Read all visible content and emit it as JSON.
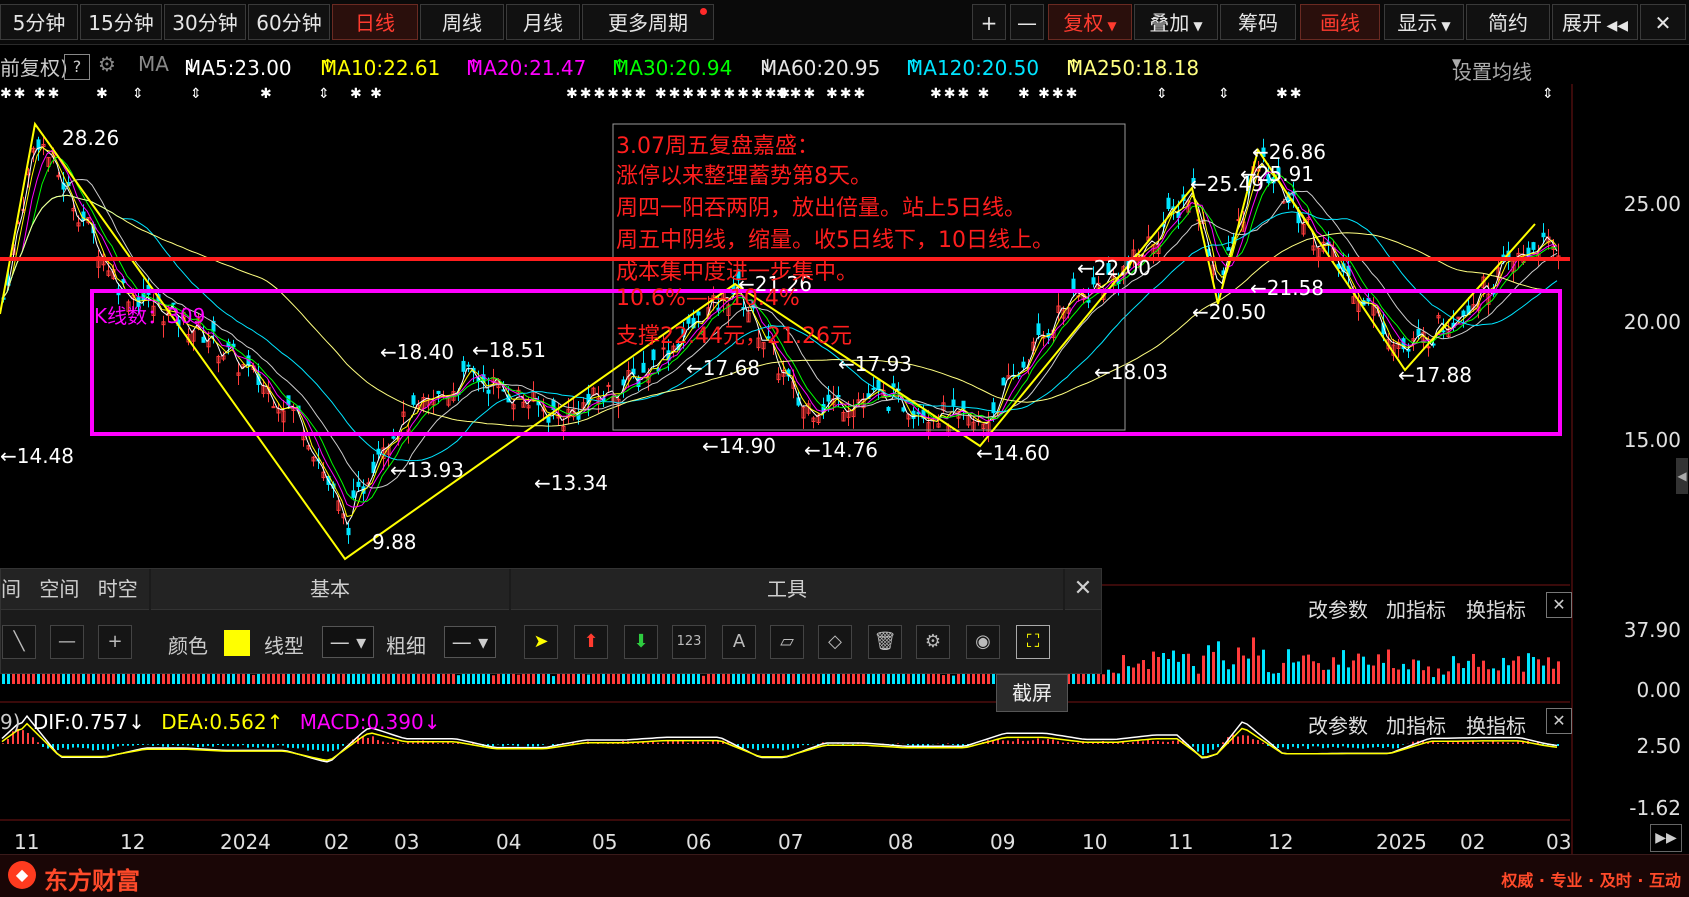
{
  "toolbar": {
    "periods": [
      "5分钟",
      "15分钟",
      "30分钟",
      "60分钟",
      "日线",
      "周线",
      "月线",
      "更多周期"
    ],
    "active_period": "日线",
    "right_buttons": [
      "+",
      "—",
      "复权",
      "叠加",
      "筹码",
      "画线",
      "显示",
      "简约",
      "展开"
    ],
    "collapse_icon": "collapse-arrows-icon"
  },
  "ma_bar": {
    "prefix": "前复权)",
    "help": "?",
    "ma_label": "MA",
    "items": [
      {
        "text": "MA5:23.00",
        "arrow": "↓",
        "color": "#ffffff"
      },
      {
        "text": "MA10:22.61",
        "arrow": "↑",
        "color": "#ffff00"
      },
      {
        "text": "MA20:21.47",
        "arrow": "↑",
        "color": "#ff00ff"
      },
      {
        "text": "MA30:20.94",
        "arrow": "↑",
        "color": "#00ff00"
      },
      {
        "text": "MA60:20.95",
        "arrow": "↓",
        "color": "#e6e6e6"
      },
      {
        "text": "MA120:20.50",
        "arrow": "↑",
        "color": "#00e5ff"
      },
      {
        "text": "MA250:18.18",
        "arrow": "↑",
        "color": "#ffff80"
      }
    ],
    "settings": "设置均线"
  },
  "chart_data": {
    "type": "candlestick",
    "y_ticks": [
      "25.00",
      "20.00",
      "15.00"
    ],
    "x_ticks": [
      "11",
      "12",
      "2024",
      "02",
      "03",
      "04",
      "05",
      "06",
      "07",
      "08",
      "09",
      "10",
      "11",
      "12",
      "2025",
      "02",
      "03"
    ],
    "price_labels": [
      "28.26",
      "←26.86",
      "←25.91",
      "←25.49",
      "←22.00",
      "←21.58",
      "←21.26",
      "←20.50",
      "←18.40",
      "←18.51",
      "←18.03",
      "←17.93",
      "←17.88",
      "←17.68",
      "←14.48",
      "←14.90",
      "←14.76",
      "←14.60",
      "←13.93",
      "←13.34",
      "9.88"
    ],
    "k_count_label": "K线数：309",
    "zigzag_points": [
      [
        28.26,
        "2023-10"
      ],
      [
        9.88,
        "2024-02"
      ],
      [
        21.26,
        "2024-06"
      ],
      [
        14.6,
        "2024-09"
      ],
      [
        25.49,
        "2024-11"
      ],
      [
        20.5,
        "2024-11"
      ],
      [
        26.86,
        "2024-12"
      ],
      [
        17.88,
        "2025-01"
      ],
      [
        23.0,
        "2025-03"
      ]
    ],
    "horizontal_red_line": 22.44,
    "box_range": [
      14.6,
      21.26
    ],
    "volume_axis": [
      "37.90",
      "0.00"
    ],
    "macd_axis": [
      "2.50",
      "-1.62"
    ]
  },
  "annotation": {
    "lines": [
      "3.07周五复盘嘉盛：",
      "涨停以来整理蓄势第8天。",
      "周四一阳吞两阴，放出倍量。站上5日线。",
      "周五中阴线，缩量。收5日线下，10日线上。",
      "成本集中度进一步集中。",
      "10.6%——10.4%",
      "支撑22.44元，21.26元"
    ]
  },
  "draw_panel": {
    "tabs": [
      "间",
      "空间",
      "时空"
    ],
    "basic_title": "基本",
    "tools_title": "工具",
    "color_label": "颜色",
    "linetype_label": "线型",
    "thickness_label": "粗细",
    "tooltip": "截屏"
  },
  "indicator": {
    "vol_buttons": [
      "改参数",
      "加指标",
      "换指标"
    ],
    "macd_prefix": "9)",
    "dif": "DIF:0.757",
    "dif_arrow": "↓",
    "dea": "DEA:0.562",
    "dea_arrow": "↑",
    "macd": "MACD:0.390",
    "macd_arrow": "↓"
  },
  "footer": {
    "logo": "东方财富",
    "slogan": "权威 · 专业 · 及时 · 互动"
  },
  "colors": {
    "red": "#ff1e1e",
    "magenta": "#ff00ff",
    "yellow": "#ffff00",
    "cyan": "#00e5ff"
  }
}
